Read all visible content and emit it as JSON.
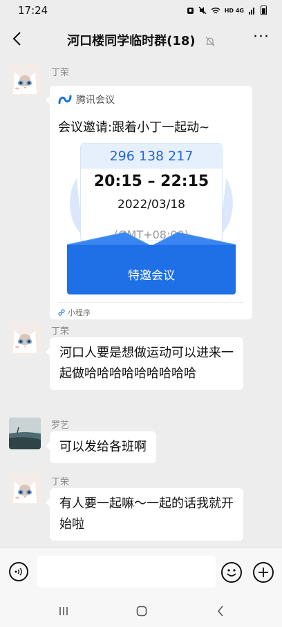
{
  "status": {
    "time": "17:24",
    "network": "HD 4G",
    "icons": [
      "alarm-icon",
      "mute-icon",
      "wifi-icon",
      "signal-icon",
      "battery-icon"
    ]
  },
  "header": {
    "title": "河口楼同学临时群(18)",
    "icons": [
      "back-icon",
      "mute-bell-icon",
      "more-icon"
    ]
  },
  "messages": [
    {
      "sender": "丁荣",
      "type": "mini-program",
      "card": {
        "source": "腾讯会议",
        "title": "会议邀请:跟着小丁一起动~",
        "meeting_id": "296 138 217",
        "time_range": "20:15 – 22:15",
        "date": "2022/03/18",
        "timezone": "(GMT+08:00)",
        "button": "特邀会议",
        "footer": "小程序"
      }
    },
    {
      "sender": "丁荣",
      "text": "河口人要是想做运动可以进来一起做哈哈哈哈哈哈哈哈哈"
    },
    {
      "sender": "罗艺",
      "text": "可以发给各班啊"
    },
    {
      "sender": "丁荣",
      "text": "有人要一起嘛～一起的话我就开始啦"
    }
  ],
  "input": {
    "placeholder": "",
    "icons": [
      "voice-icon",
      "emoji-icon",
      "plus-icon"
    ]
  },
  "colors": {
    "background": "#EDEDED",
    "bubble": "#FFFFFF",
    "accent": "#1F6FE6"
  }
}
